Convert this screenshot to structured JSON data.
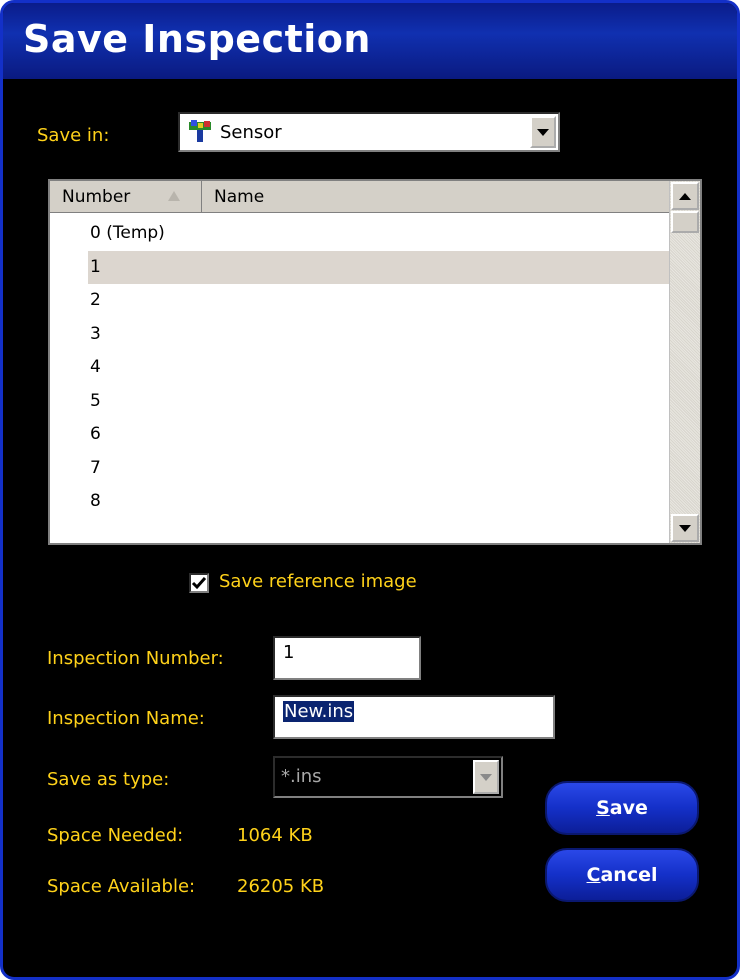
{
  "window": {
    "title": "Save Inspection"
  },
  "save_in": {
    "label": "Save in:",
    "value": "Sensor",
    "icon": "sensor-icon"
  },
  "file_list": {
    "columns": [
      "Number",
      "Name"
    ],
    "rows": [
      {
        "number": "0",
        "name": "(Temp)"
      },
      {
        "number": "1",
        "name": ""
      },
      {
        "number": "2",
        "name": ""
      },
      {
        "number": "3",
        "name": ""
      },
      {
        "number": "4",
        "name": ""
      },
      {
        "number": "5",
        "name": ""
      },
      {
        "number": "6",
        "name": ""
      },
      {
        "number": "7",
        "name": ""
      },
      {
        "number": "8",
        "name": ""
      }
    ],
    "selected_row": "1"
  },
  "options": {
    "save_reference_image_label": "Save reference image",
    "save_reference_image_checked": true
  },
  "fields": {
    "inspection_number_label": "Inspection Number:",
    "inspection_number_value": "1",
    "inspection_name_label": "Inspection Name:",
    "inspection_name_value": "New.ins",
    "save_as_type_label": "Save as type:",
    "save_as_type_value": "*.ins"
  },
  "info": {
    "space_needed_label": "Space Needed:",
    "space_needed_value": "1064 KB",
    "space_available_label": "Space Available:",
    "space_available_value": "26205 KB"
  },
  "buttons": {
    "save_first": "S",
    "save_rest": "ave",
    "cancel_first": "C",
    "cancel_rest": "ancel"
  },
  "colors": {
    "label": "#ffd21a",
    "title_bar": "#1030b0",
    "button": "#1430c8"
  }
}
